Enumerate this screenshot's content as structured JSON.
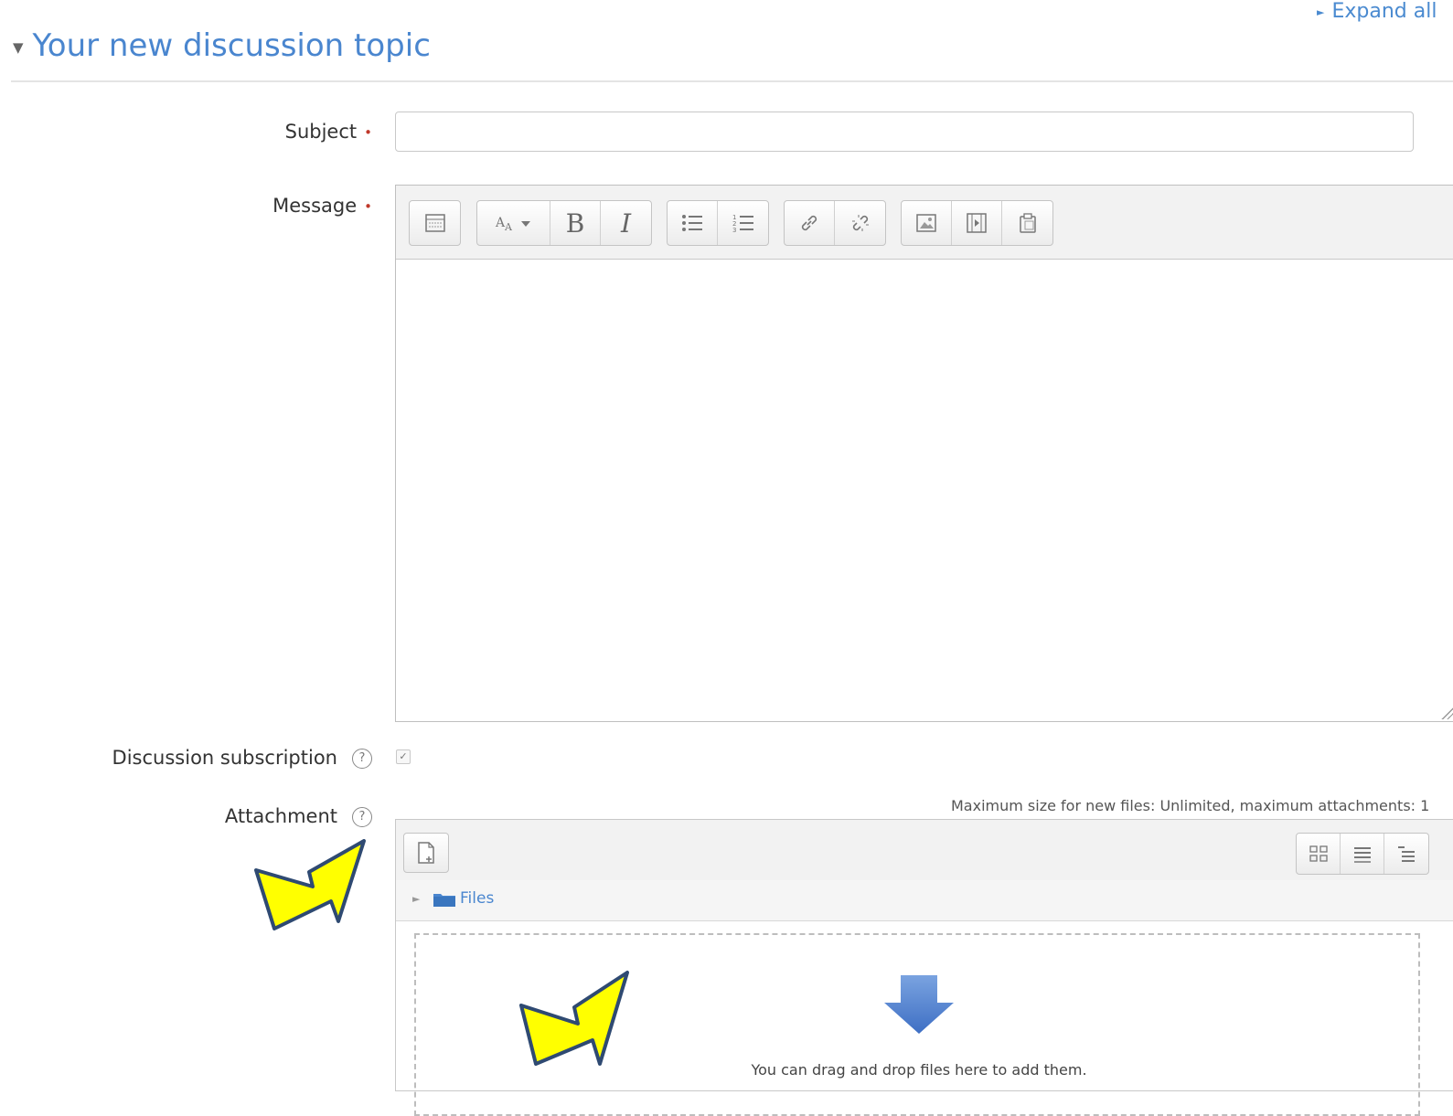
{
  "header": {
    "expand_all": "Expand all",
    "section_title": "Your new discussion topic"
  },
  "form": {
    "subject_label": "Subject",
    "subject_value": "",
    "message_label": "Message",
    "subscription_label": "Discussion subscription",
    "subscription_checked": true,
    "attachment_label": "Attachment",
    "required_mark": "•",
    "help_glyph": "?"
  },
  "editor": {
    "toolbar_groups": [
      [
        "show-more-icon"
      ],
      [
        "font-style-icon",
        "bold-icon",
        "italic-icon"
      ],
      [
        "unordered-list-icon",
        "ordered-list-icon"
      ],
      [
        "link-icon",
        "unlink-icon"
      ],
      [
        "image-icon",
        "media-icon",
        "manage-files-icon"
      ]
    ],
    "bold_label": "B",
    "italic_label": "I"
  },
  "filepicker": {
    "max_size_text": "Maximum size for new files: Unlimited, maximum attachments: 1",
    "folder_label": "Files",
    "drop_text": "You can drag and drop files here to add them.",
    "views": [
      "icons-view-icon",
      "list-view-icon",
      "tree-view-icon"
    ]
  },
  "colors": {
    "link_blue": "#4a86cf",
    "required_red": "#c0392b",
    "annotation_yellow": "#ffff00",
    "annotation_outline": "#2f4a72"
  }
}
